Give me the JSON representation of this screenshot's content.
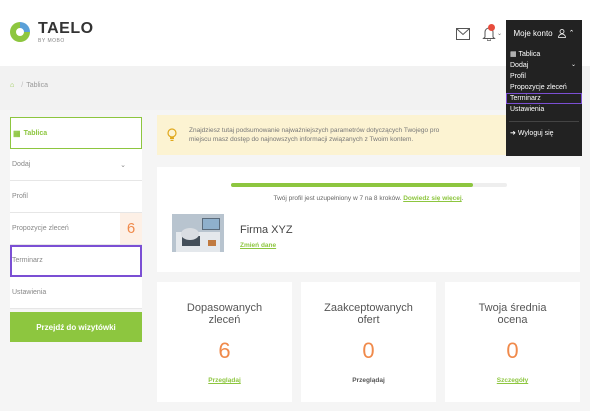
{
  "header": {
    "brand": "TAELO",
    "brand_sub": "BY MOBO",
    "account_label": "Moje konto"
  },
  "dropdown": {
    "items": [
      {
        "label": "Tablica",
        "has_chevron": false
      },
      {
        "label": "Dodaj",
        "has_chevron": true
      },
      {
        "label": "Profil",
        "has_chevron": false
      },
      {
        "label": "Propozycje zleceń",
        "has_chevron": false
      },
      {
        "label": "Terminarz",
        "has_chevron": false
      },
      {
        "label": "Ustawienia",
        "has_chevron": false
      }
    ],
    "logout_label": "Wyloguj się"
  },
  "breadcrumb": {
    "current": "Tablica"
  },
  "sidebar": {
    "items": [
      {
        "label": "Tablica"
      },
      {
        "label": "Dodaj"
      },
      {
        "label": "Profil"
      },
      {
        "label": "Propozycje zleceń",
        "count": "6"
      },
      {
        "label": "Terminarz"
      },
      {
        "label": "Ustawienia"
      }
    ],
    "cta_label": "Przejdź do wizytówki"
  },
  "info": {
    "line1": "Znajdziesz tutaj podsumowanie najważniejszych parametrów dotyczących Twojego pro",
    "line2": "miejscu masz dostęp do najnowszych informacji związanych z Twoim kontem."
  },
  "profile": {
    "progress_fraction": 0.875,
    "progress_text": "Twój profil jest uzupełniony w 7 na 8 kroków.",
    "progress_link": "Dowiedz się więcej",
    "progress_end": ".",
    "company_name": "Firma XYZ",
    "edit_label": "Zmień dane"
  },
  "stats": [
    {
      "title_line1": "Dopasowanych",
      "title_line2": "zleceń",
      "value": "6",
      "link": "Przeglądaj"
    },
    {
      "title_line1": "Zaakceptowanych",
      "title_line2": "ofert",
      "value": "0",
      "link": "Przeglądaj"
    },
    {
      "title_line1": "Twoja średnia",
      "title_line2": "ocena",
      "value": "0",
      "link": "Szczegóły"
    }
  ],
  "colors": {
    "accent": "#8dc63f",
    "orange": "#f08a4b",
    "dark": "#222222",
    "highlight": "#7b4fd4"
  }
}
